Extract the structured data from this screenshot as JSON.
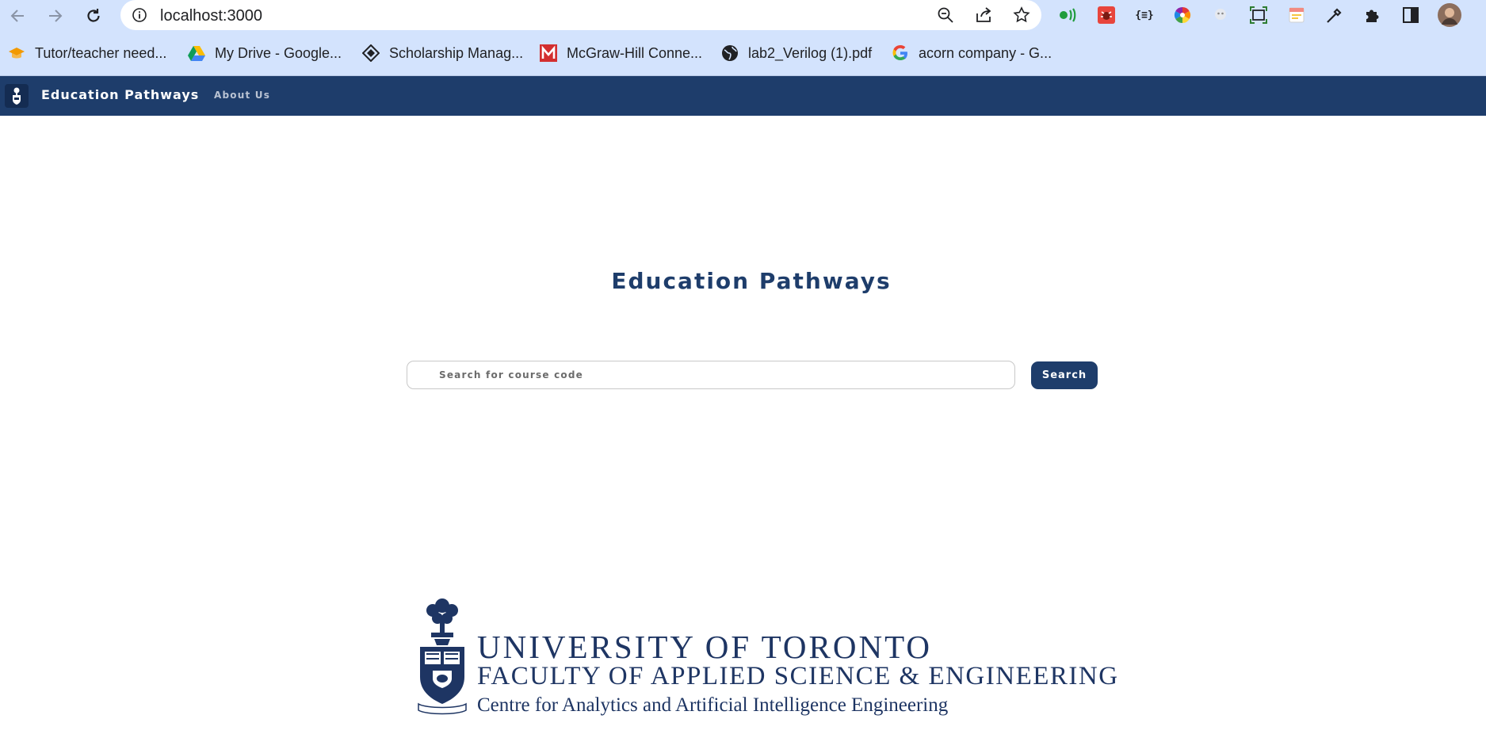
{
  "browser": {
    "url": "localhost:3000",
    "bookmarks": [
      {
        "label": "Tutor/teacher need...",
        "icon": "graduation-cap-icon"
      },
      {
        "label": "My Drive - Google...",
        "icon": "google-drive-icon"
      },
      {
        "label": "Scholarship Manag...",
        "icon": "diamond-logo-icon"
      },
      {
        "label": "McGraw-Hill Conne...",
        "icon": "mcgraw-hill-icon"
      },
      {
        "label": "lab2_Verilog (1).pdf",
        "icon": "globe-icon"
      },
      {
        "label": "acorn company - G...",
        "icon": "google-icon"
      }
    ],
    "extensions": [
      "green-sound-extension-icon",
      "red-bug-extension-icon",
      "json-extension-icon",
      "color-wheel-extension-icon",
      "ghost-extension-icon",
      "screenshot-extension-icon",
      "notes-extension-icon",
      "eyedropper-extension-icon",
      "puzzle-extensions-icon",
      "side-panel-icon",
      "profile-avatar-icon"
    ],
    "extension_labels": {
      "json": "{≡}"
    }
  },
  "app": {
    "brand": "Education Pathways",
    "nav_about": "About Us",
    "title": "Education Pathways",
    "search_placeholder": "Search for course code",
    "search_button": "Search",
    "accent_color": "#1e3d6b"
  },
  "footer": {
    "line1": "UNIVERSITY OF TORONTO",
    "line2": "FACULTY OF APPLIED SCIENCE & ENGINEERING",
    "line3": "Centre for Analytics and Artificial Intelligence Engineering"
  }
}
